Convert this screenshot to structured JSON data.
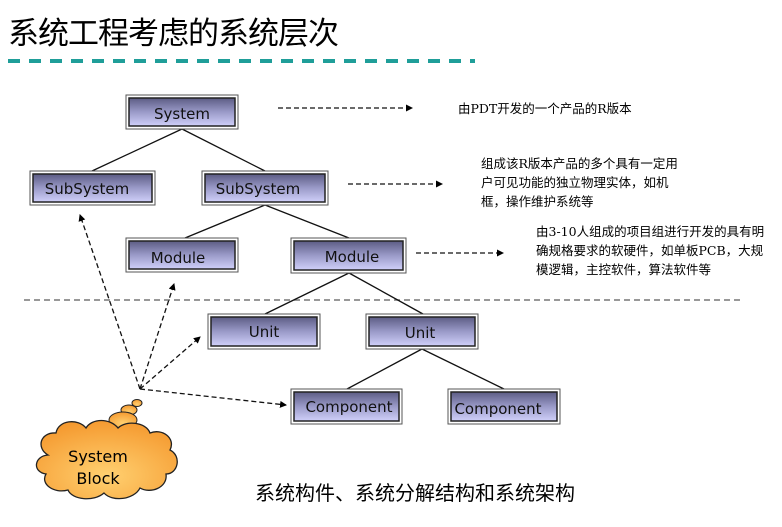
{
  "title": "系统工程考虑的系统层次",
  "colors": {
    "title_rule": "#1f9e99",
    "node_fill_top": "#5e5e86",
    "node_fill_bottom": "#ccccf6",
    "node_border": "#333333",
    "cloud_fill": "#f8a848",
    "divider": "#777777"
  },
  "nodes": {
    "system": "System",
    "subsystem_left": "SubSystem",
    "subsystem_right": "SubSystem",
    "module_left": "Module",
    "module_right": "Module",
    "unit_left": "Unit",
    "unit_right": "Unit",
    "component_left": "Component",
    "component_right": "Component"
  },
  "notes": {
    "system": "由PDT开发的一个产品的R版本",
    "subsystem": "组成该R版本产品的多个具有一定用户可见功能的独立物理实体，如机框，操作维护系统等",
    "module": "由3-10人组成的项目组进行开发的具有明确规格要求的软硬件，如单板PCB，大规模逻辑，主控软件，算法软件等"
  },
  "cloud": {
    "line1": "System",
    "line2": "Block"
  },
  "caption": "系统构件、系统分解结构和系统架构"
}
